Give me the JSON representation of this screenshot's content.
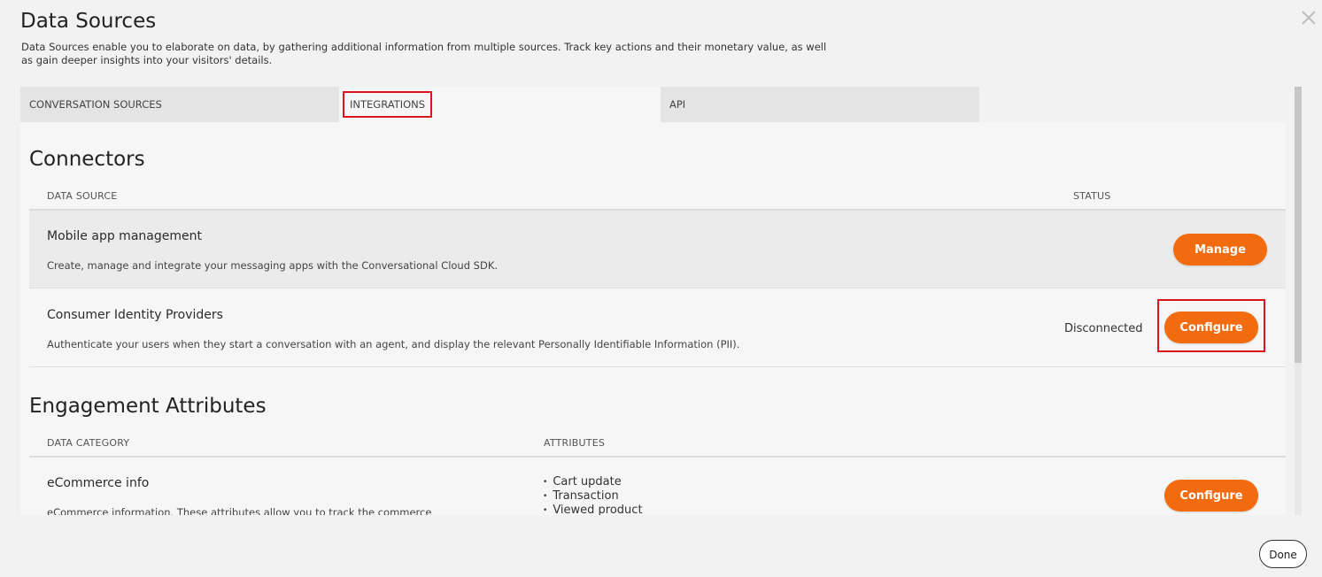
{
  "dialog": {
    "title": "Data Sources",
    "description": "Data Sources enable you to elaborate on data, by gathering additional information from multiple sources. Track key actions and their monetary value, as well as gain deeper insights into your visitors' details.",
    "close_icon": "close-icon",
    "done_label": "Done"
  },
  "tabs": [
    {
      "label": "CONVERSATION SOURCES",
      "active": false
    },
    {
      "label": "INTEGRATIONS",
      "active": true
    },
    {
      "label": "API",
      "active": false
    }
  ],
  "connectors": {
    "title": "Connectors",
    "columns": {
      "data_source": "DATA SOURCE",
      "status": "STATUS"
    },
    "rows": [
      {
        "name": "Mobile app management",
        "description": "Create, manage and integrate your messaging apps with the Conversational Cloud SDK.",
        "status": "",
        "action": "Manage"
      },
      {
        "name": "Consumer Identity Providers",
        "description": "Authenticate your users when they start a conversation with an agent, and display the relevant Personally Identifiable Information (PII).",
        "status": "Disconnected",
        "action": "Configure"
      }
    ]
  },
  "engagement": {
    "title": "Engagement Attributes",
    "columns": {
      "data_category": "DATA CATEGORY",
      "attributes": "ATTRIBUTES"
    },
    "rows": [
      {
        "name": "eCommerce info",
        "description": "eCommerce information. These attributes allow you to track the commerce interests and activity of your visitors.",
        "attributes": [
          "Cart update",
          "Transaction",
          "Viewed product"
        ],
        "action": "Configure"
      }
    ]
  },
  "colors": {
    "accent": "#f26b0f",
    "highlight": "#d8141c"
  }
}
